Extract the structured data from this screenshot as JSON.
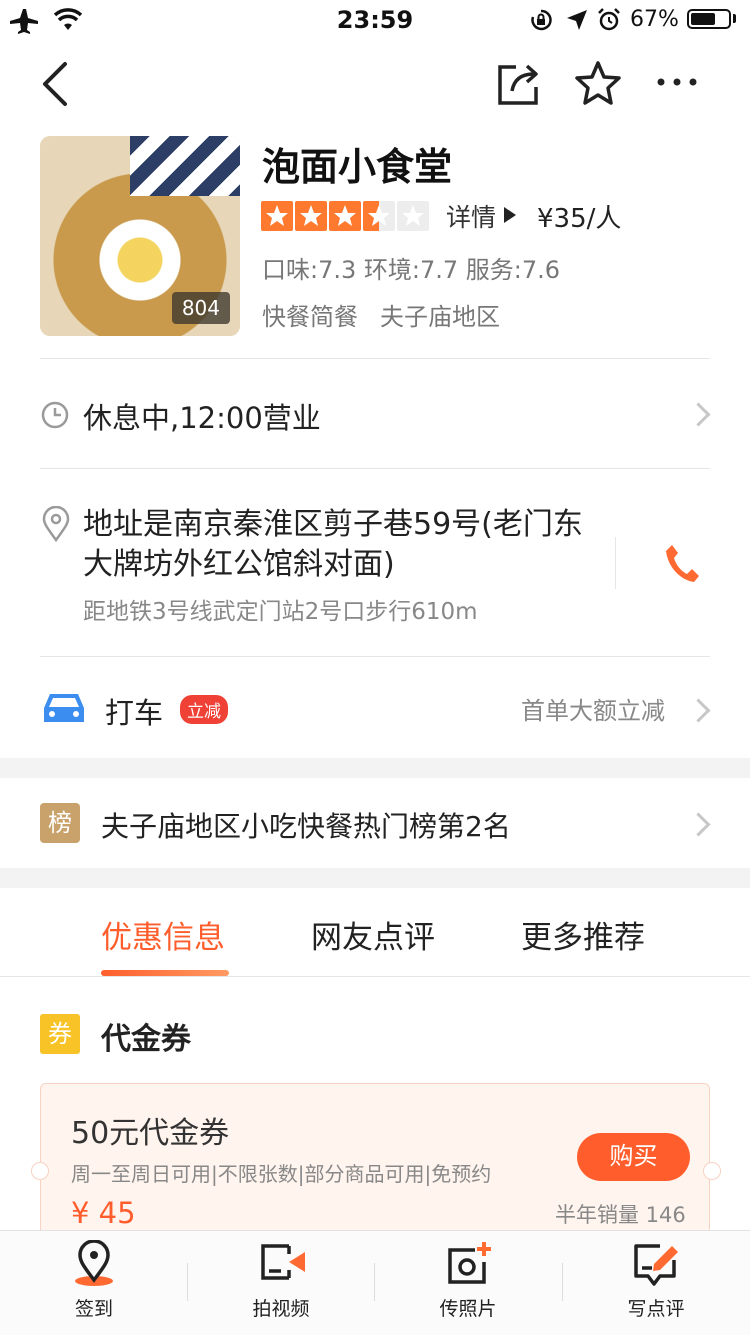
{
  "status_bar": {
    "time": "23:59",
    "battery_percent": "67%",
    "battery_level": 0.67
  },
  "nav": {
    "back_icon": "chevron-left-icon",
    "share_icon": "share-icon",
    "favorite_icon": "star-outline-icon",
    "more_icon": "more-horizontal-icon"
  },
  "shop": {
    "name": "泡面小食堂",
    "photo_count": "804",
    "rating": 3.5,
    "details_label": "详情",
    "price_per_person": "¥35/人",
    "scores": "口味:7.3 环境:7.7 服务:7.6",
    "category": "快餐简餐",
    "area": "夫子庙地区"
  },
  "hours": {
    "text": "休息中,12:00营业"
  },
  "address": {
    "text": "地址是南京秦淮区剪子巷59号(老门东大牌坊外红公馆斜对面)",
    "subway": "距地铁3号线武定门站2号口步行610m"
  },
  "taxi": {
    "label": "打车",
    "badge": "立减",
    "promo": "首单大额立减"
  },
  "ranking": {
    "icon_text": "榜",
    "text": "夫子庙地区小吃快餐热门榜第2名"
  },
  "tabs": {
    "items": [
      {
        "label": "优惠信息",
        "active": true
      },
      {
        "label": "网友点评",
        "active": false
      },
      {
        "label": "更多推荐",
        "active": false
      }
    ]
  },
  "coupon_section": {
    "icon_text": "券",
    "title": "代金券"
  },
  "coupon": {
    "title": "50元代金券",
    "subtitle": "周一至周日可用|不限张数|部分商品可用|免预约",
    "price": "¥ 45",
    "buy_label": "购买",
    "sales": "半年销量 146"
  },
  "tabbar": {
    "items": [
      {
        "label": "签到",
        "icon": "location-checkin-icon"
      },
      {
        "label": "拍视频",
        "icon": "video-camera-icon"
      },
      {
        "label": "传照片",
        "icon": "add-photo-icon"
      },
      {
        "label": "写点评",
        "icon": "write-review-icon"
      }
    ]
  },
  "colors": {
    "accent": "#ff5e2c",
    "star_fill": "#ff7a2e",
    "taxi_blue": "#3b8ef0",
    "badge_red": "#ef4135"
  }
}
